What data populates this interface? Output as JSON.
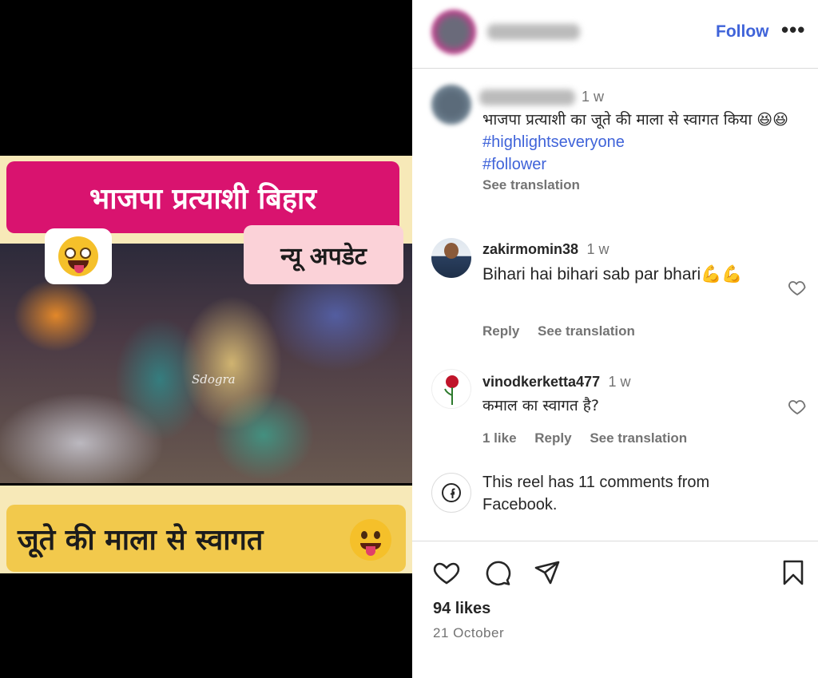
{
  "media": {
    "title_text": "भाजपा प्रत्याशी बिहार",
    "subtitle_text": "न्यू अपडेट",
    "watermark": "Sdogra",
    "bottom_text": "जूते की माला से स्वागत"
  },
  "header": {
    "follow_label": "Follow",
    "more_label": "•••"
  },
  "caption": {
    "time": "1 w",
    "text": "भाजपा प्रत्याशी का जूते की माला से स्वागत किया 😆😆",
    "hashtags": [
      "#highlightseveryone",
      "#follower"
    ],
    "see_translation": "See translation"
  },
  "comments": [
    {
      "username": "zakirmomin38",
      "time": "1 w",
      "text": "Bihari hai bihari sab par bhari💪💪",
      "reply": "Reply",
      "see_translation": "See translation"
    },
    {
      "username": "vinodkerketta477",
      "time": "1 w",
      "text": "कमाल का स्वागत है?",
      "likes": "1 like",
      "reply": "Reply",
      "see_translation": "See translation"
    }
  ],
  "facebook_notice": "This reel has 11 comments from Facebook.",
  "footer": {
    "likes": "94 likes",
    "date": "21 October"
  },
  "icons": {
    "like": "heart-icon",
    "comment": "comment-icon",
    "share": "share-icon",
    "save": "bookmark-icon"
  },
  "colors": {
    "follow_blue": "#3f63d9",
    "title_pink": "#d9136f",
    "bottom_yellow": "#f2c94c"
  }
}
